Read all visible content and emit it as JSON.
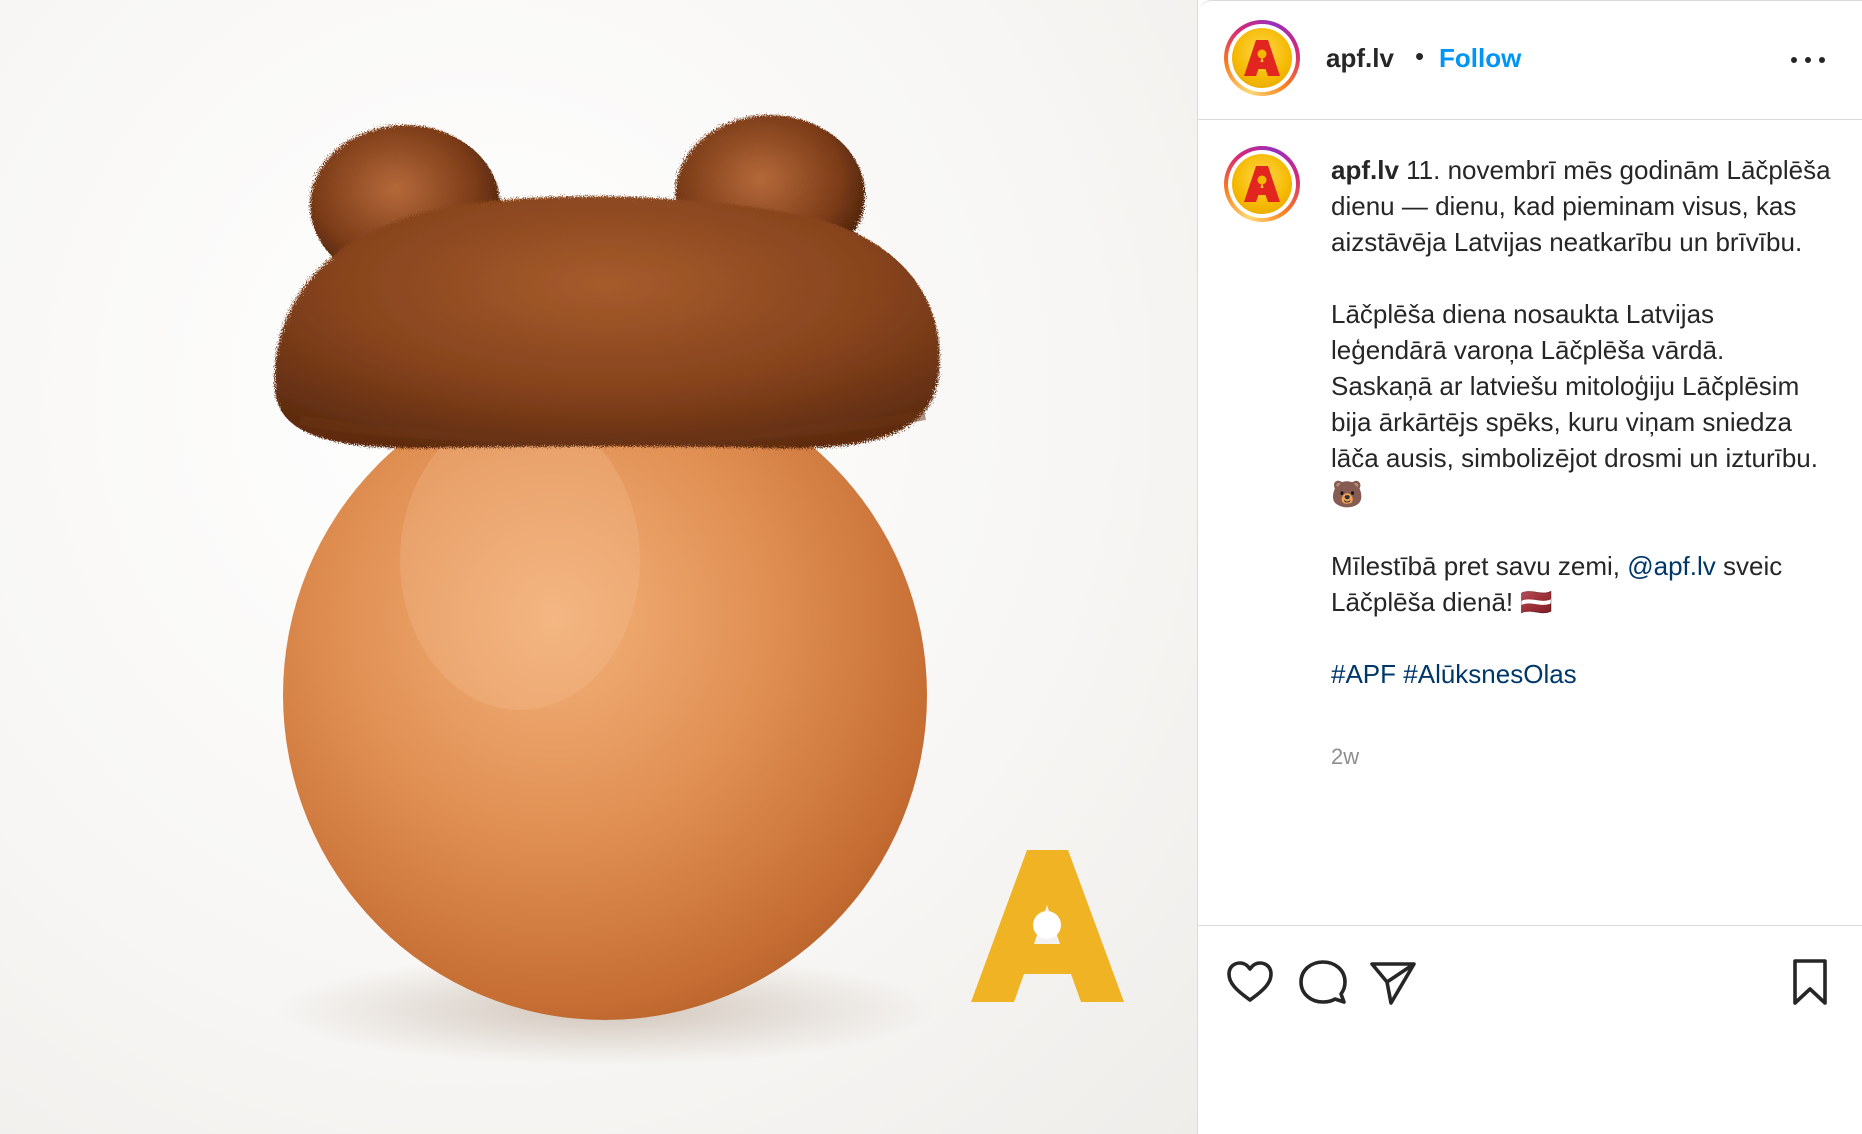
{
  "post": {
    "username": "apf.lv",
    "separator": "•",
    "follow_label": "Follow",
    "logo_letter": "A"
  },
  "caption": {
    "username": "apf.lv",
    "paragraph1": "11. novembrī mēs godinām Lāčplēša dienu — dienu, kad pieminam visus, kas aizstāvēja Latvijas neatkarību un brīvību.",
    "paragraph2": "Lāčplēša diena nosaukta Latvijas leģendārā varoņa Lāčplēša vārdā. Saskaņā ar latviešu mitoloģiju Lāčplēsim bija ārkārtējs spēks, kuru viņam sniedza lāča ausis, simbolizējot drosmi un izturību. 🐻",
    "paragraph3_prefix": "Mīlestībā pret savu zemi,",
    "mention": "@apf.lv",
    "paragraph3_suffix": "sveic Lāčplēša dienā! 🇱🇻",
    "hashtag1": "#APF",
    "hashtag2": "#AlūksnesOlas",
    "timestamp": "2w"
  },
  "icons": {
    "more": "more-horizontal-icon",
    "like": "heart-icon",
    "comment": "comment-icon",
    "share": "paper-plane-icon",
    "save": "bookmark-icon"
  },
  "colors": {
    "follow": "#0095f6",
    "link": "#00376b",
    "logo_yellow": "#f0b323",
    "egg": "#d9864a",
    "fur": "#8a4a25"
  }
}
